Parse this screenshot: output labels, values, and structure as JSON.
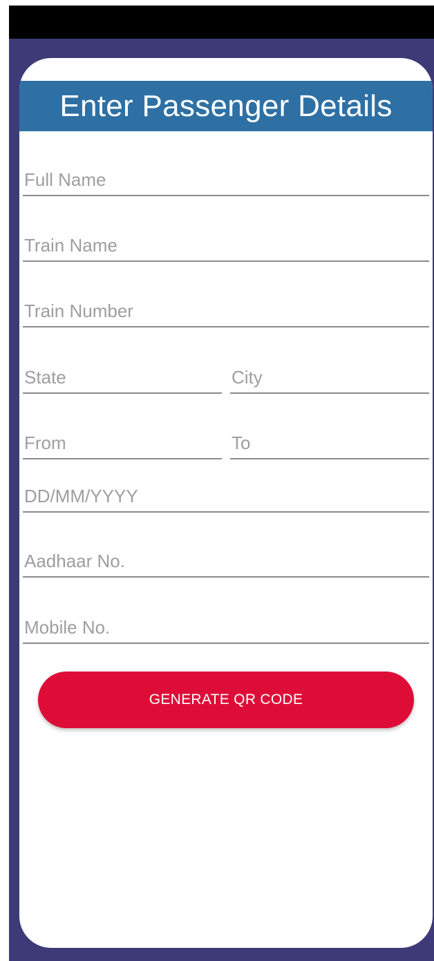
{
  "header": {
    "title": "Enter Passenger Details"
  },
  "form": {
    "full_name": {
      "placeholder": "Full Name",
      "value": ""
    },
    "train_name": {
      "placeholder": "Train Name",
      "value": ""
    },
    "train_number": {
      "placeholder": "Train Number",
      "value": ""
    },
    "state": {
      "placeholder": "State",
      "value": ""
    },
    "city": {
      "placeholder": "City",
      "value": ""
    },
    "from": {
      "placeholder": "From",
      "value": ""
    },
    "to": {
      "placeholder": "To",
      "value": ""
    },
    "date": {
      "placeholder": "DD/MM/YYYY",
      "value": ""
    },
    "aadhaar": {
      "placeholder": "Aadhaar No.",
      "value": ""
    },
    "mobile": {
      "placeholder": "Mobile No.",
      "value": ""
    }
  },
  "actions": {
    "generate_label": "GENERATE QR CODE"
  },
  "colors": {
    "app_background": "#3e3a78",
    "header_bar": "#2e70a4",
    "primary_button": "#de0d38",
    "status_bar": "#000000"
  }
}
